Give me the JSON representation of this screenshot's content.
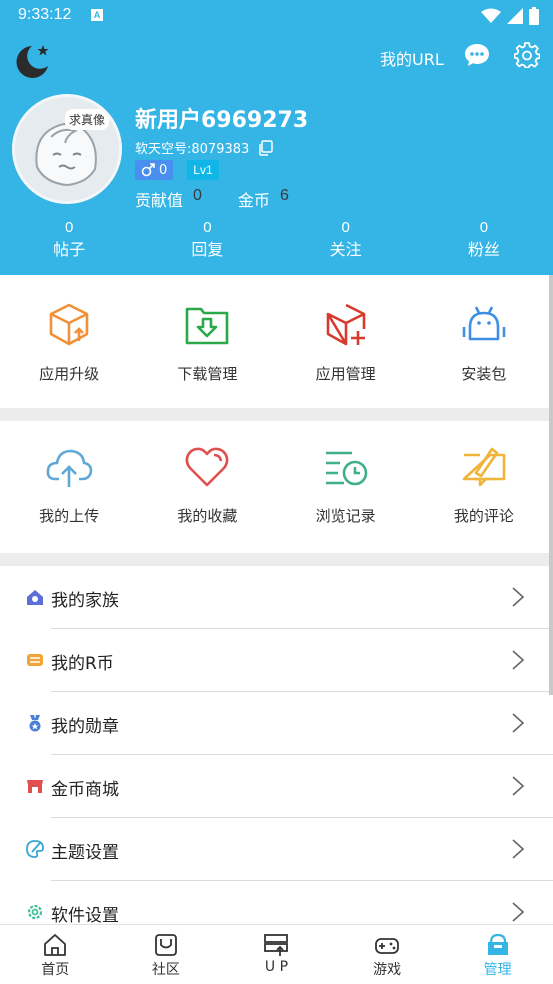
{
  "status_bar": {
    "time": "9:33:12",
    "notification_glyph": "A",
    "icons": [
      "wifi-icon",
      "signal-icon",
      "battery-icon"
    ]
  },
  "header": {
    "bg_color": "#35b4e6",
    "url_label": "我的URL",
    "icons": [
      "moon-logo-icon",
      "chat-bubble-icon",
      "settings-gear-icon"
    ],
    "avatar_tag": "求真像",
    "username": "新用户6969273",
    "id_line": "软天空号:8079383",
    "gender_count": "0",
    "level": "Lv1",
    "contribution_label": "贡献值",
    "contribution_value": "0",
    "coins_label": "金币",
    "coins_value": "6",
    "stats": [
      {
        "value": "0",
        "label": "帖子"
      },
      {
        "value": "0",
        "label": "回复"
      },
      {
        "value": "0",
        "label": "关注"
      },
      {
        "value": "0",
        "label": "粉丝"
      }
    ]
  },
  "tools_grid": [
    {
      "label": "应用升级",
      "icon": "app-upgrade-icon",
      "color": "#f0913a"
    },
    {
      "label": "下载管理",
      "icon": "download-folder-icon",
      "color": "#2aa84a"
    },
    {
      "label": "应用管理",
      "icon": "app-manage-icon",
      "color": "#d83a2e"
    },
    {
      "label": "安装包",
      "icon": "android-package-icon",
      "color": "#3f8fe6"
    }
  ],
  "personal_grid": [
    {
      "label": "我的上传",
      "icon": "cloud-upload-icon",
      "color": "#5fa8d6"
    },
    {
      "label": "我的收藏",
      "icon": "heart-icon",
      "color": "#e0504e"
    },
    {
      "label": "浏览记录",
      "icon": "history-clock-icon",
      "color": "#3fb08a"
    },
    {
      "label": "我的评论",
      "icon": "comment-pen-icon",
      "color": "#f0b43a"
    }
  ],
  "menu": [
    {
      "label": "我的家族",
      "icon": "family-house-icon",
      "color": "#5b6fd6"
    },
    {
      "label": "我的R币",
      "icon": "coin-stack-icon",
      "color": "#f0a43a"
    },
    {
      "label": "我的勋章",
      "icon": "medal-icon",
      "color": "#4a7fd6"
    },
    {
      "label": "金币商城",
      "icon": "shop-icon",
      "color": "#e0504e"
    },
    {
      "label": "主题设置",
      "icon": "palette-icon",
      "color": "#35a5d6"
    },
    {
      "label": "软件设置",
      "icon": "gear-icon",
      "color": "#3fbf9a"
    }
  ],
  "bottom_nav": [
    {
      "label": "首页",
      "icon": "home-icon",
      "active": false
    },
    {
      "label": "社区",
      "icon": "community-icon",
      "active": false
    },
    {
      "label": "U P",
      "icon": "upload-server-icon",
      "active": false
    },
    {
      "label": "游戏",
      "icon": "gamepad-icon",
      "active": false
    },
    {
      "label": "管理",
      "icon": "manage-box-icon",
      "active": true
    }
  ]
}
